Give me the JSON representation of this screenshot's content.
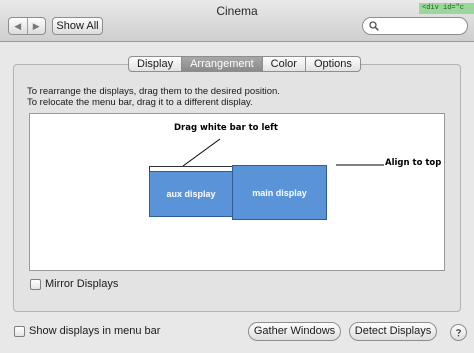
{
  "window": {
    "title": "Cinema"
  },
  "toolbar": {
    "back_glyph": "◀",
    "forward_glyph": "▶",
    "show_all_label": "Show All",
    "search_value": "",
    "search_placeholder": ""
  },
  "overlay": {
    "dev_tag": "<div id=\"c"
  },
  "tabs": [
    {
      "label": "Display",
      "active": false
    },
    {
      "label": "Arrangement",
      "active": true
    },
    {
      "label": "Color",
      "active": false
    },
    {
      "label": "Options",
      "active": false
    }
  ],
  "instructions": {
    "line1": "To rearrange the displays, drag them to the desired position.",
    "line2": "To relocate the menu bar, drag it to a different display."
  },
  "arrangement": {
    "displays": {
      "aux_label": "aux display",
      "main_label": "main display"
    },
    "annotations": {
      "drag_note": "Drag white bar to left",
      "align_note": "Align to top"
    }
  },
  "mirror": {
    "label": "Mirror Displays",
    "checked": false
  },
  "footer": {
    "menu_bar_label": "Show displays in menu bar",
    "menu_bar_checked": false,
    "gather_label": "Gather Windows",
    "detect_label": "Detect Displays"
  },
  "colors": {
    "display_fill": "#5b93d8",
    "display_border": "#2e5d98",
    "active_tab": "#8e8e8e"
  },
  "icons": {
    "search": "magnifier-icon",
    "back": "chevron-left-icon",
    "forward": "chevron-right-icon"
  }
}
